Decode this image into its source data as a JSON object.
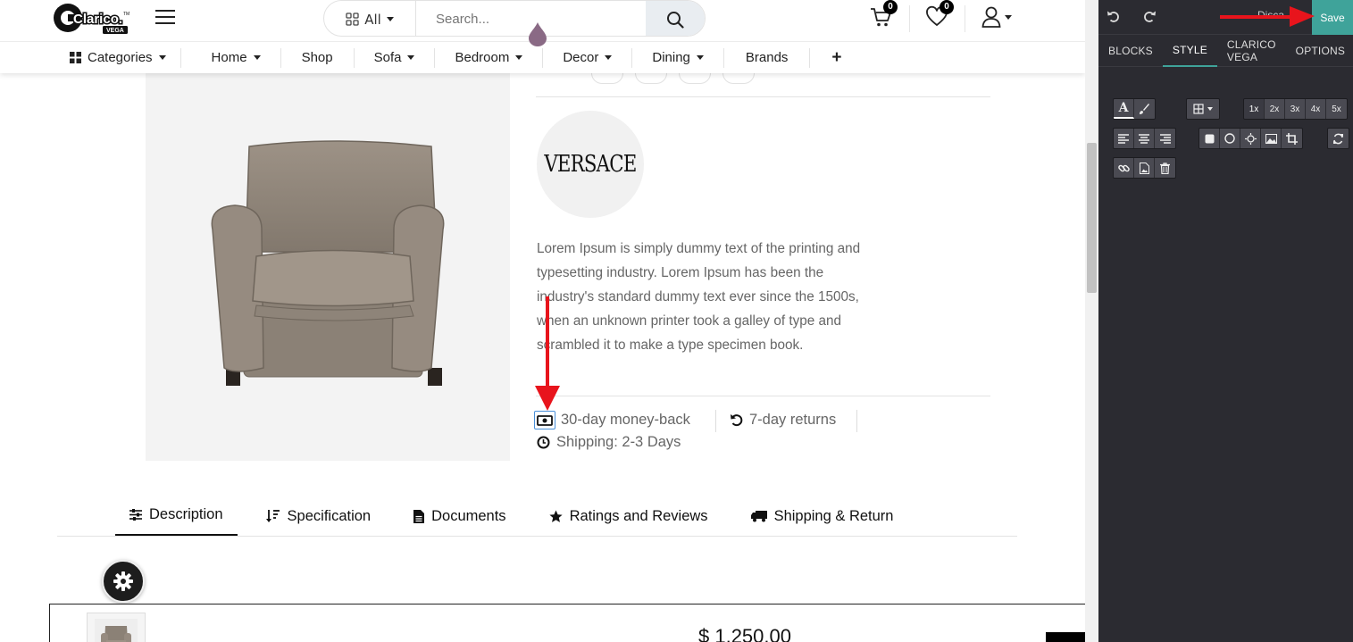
{
  "header": {
    "logo_text": "Clarico.",
    "logo_tm": "TM",
    "logo_sub": "VEGA",
    "search": {
      "category": "All",
      "placeholder": "Search..."
    },
    "cart_count": "0",
    "wishlist_count": "0"
  },
  "nav": {
    "items": [
      {
        "label": "Categories",
        "caret": true
      },
      {
        "label": "Home",
        "caret": true
      },
      {
        "label": "Shop",
        "caret": false
      },
      {
        "label": "Sofa",
        "caret": true
      },
      {
        "label": "Bedroom",
        "caret": true
      },
      {
        "label": "Decor",
        "caret": true
      },
      {
        "label": "Dining",
        "caret": true
      },
      {
        "label": "Brands",
        "caret": false
      }
    ],
    "plus": "+"
  },
  "product": {
    "brand": "VERSACE",
    "description": "Lorem Ipsum is simply dummy text of the printing and typesetting industry. Lorem Ipsum has been the industry's standard dummy text ever since the 1500s, when an unknown printer took a galley of type and scrambled it to make a type specimen book.",
    "features": {
      "money_back": "30-day money-back",
      "returns": "7-day returns",
      "shipping": "Shipping: 2-3 Days"
    },
    "price": "$ 1,250.00"
  },
  "tabs": [
    {
      "label": "Description",
      "icon": "sliders-icon"
    },
    {
      "label": "Specification",
      "icon": "sort-icon"
    },
    {
      "label": "Documents",
      "icon": "file-icon"
    },
    {
      "label": "Ratings and Reviews",
      "icon": "star-icon"
    },
    {
      "label": "Shipping & Return",
      "icon": "truck-icon"
    }
  ],
  "editor": {
    "discard_label": "Disca",
    "save_label": "Save",
    "tabs": [
      "BLOCKS",
      "STYLE",
      "CLARICO VEGA",
      "OPTIONS"
    ],
    "active_tab": "STYLE",
    "sizes": [
      "1x",
      "2x",
      "3x",
      "4x",
      "5x"
    ],
    "accent": "#3fa39a"
  },
  "colors": {
    "annotation_arrow": "#e8141c",
    "drop_marker": "#8a6a85"
  }
}
